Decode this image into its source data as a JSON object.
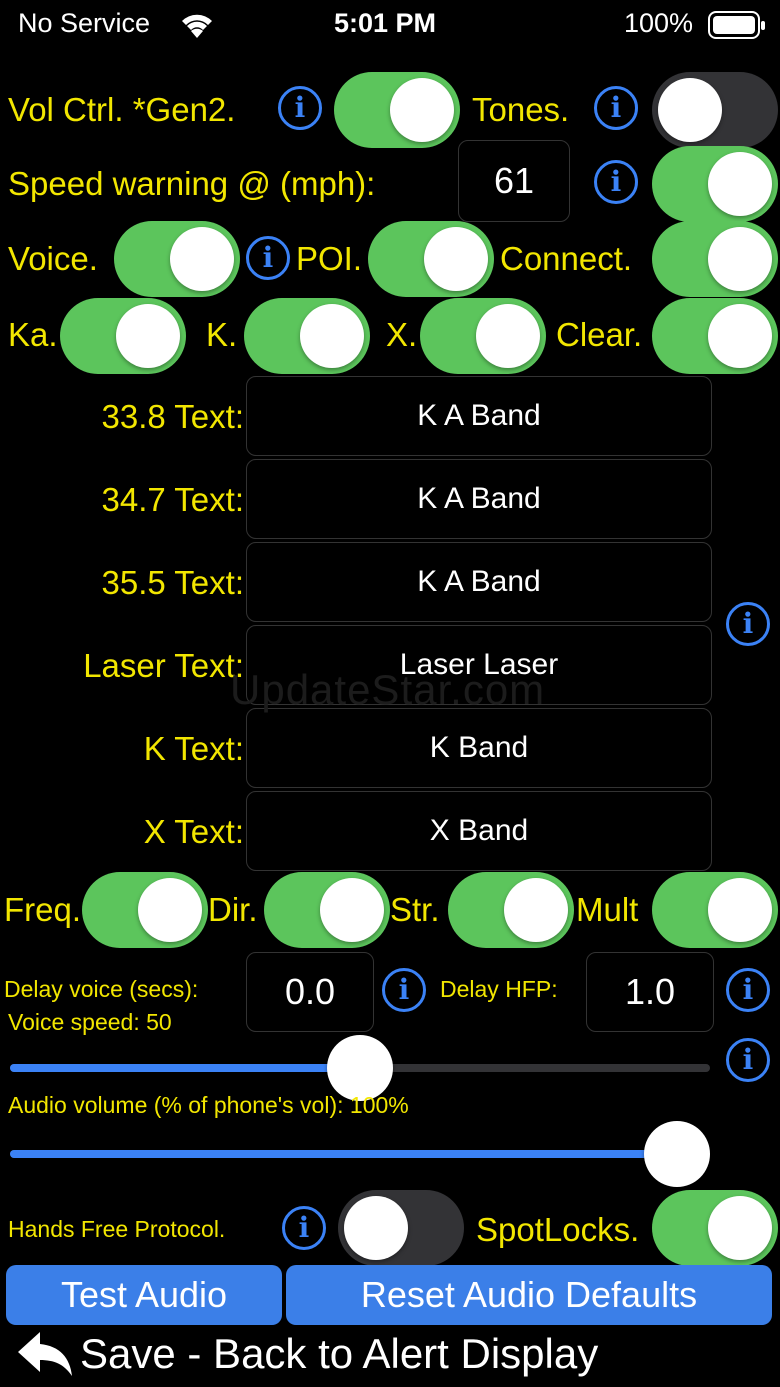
{
  "status_bar": {
    "carrier": "No Service",
    "time": "5:01 PM",
    "battery": "100%"
  },
  "row1": {
    "vol_ctrl": "Vol Ctrl. *Gen2.",
    "tones": "Tones."
  },
  "speed": {
    "label": "Speed warning @ (mph):",
    "value": "61"
  },
  "row3": {
    "voice": "Voice.",
    "poi": "POI.",
    "connect": "Connect."
  },
  "bands": {
    "ka": "Ka.",
    "k": "K.",
    "x": "X.",
    "clear": "Clear."
  },
  "text_fields": [
    {
      "label": "33.8 Text:",
      "value": "K A Band"
    },
    {
      "label": "34.7 Text:",
      "value": "K A Band"
    },
    {
      "label": "35.5 Text:",
      "value": "K A Band"
    },
    {
      "label": "Laser Text:",
      "value": "Laser Laser"
    },
    {
      "label": "K Text:",
      "value": "K Band"
    },
    {
      "label": "X Text:",
      "value": "X Band"
    }
  ],
  "watermark": "UpdateStar.com",
  "row_freq": {
    "freq": "Freq.",
    "dir": "Dir.",
    "str": "Str.",
    "mult": "Mult"
  },
  "delay": {
    "voice_label": "Delay voice (secs):",
    "voice_value": "0.0",
    "hfp_label": "Delay HFP:",
    "hfp_value": "1.0"
  },
  "voice_speed": {
    "label": "Voice speed: 50",
    "level": 0.5
  },
  "audio_volume": {
    "label": "Audio volume (% of phone's vol): 100%",
    "level": 1.0
  },
  "bottom": {
    "hfp": "Hands Free Protocol.",
    "spotlocks": "SpotLocks."
  },
  "buttons": {
    "test_audio": "Test Audio",
    "reset": "Reset Audio Defaults",
    "save_back": "Save - Back to Alert Display"
  },
  "colors": {
    "accent_yellow": "#f2e600",
    "toggle_green": "#5cc55c",
    "info_blue": "#3b82f6",
    "button_blue": "#3b7fe8"
  }
}
